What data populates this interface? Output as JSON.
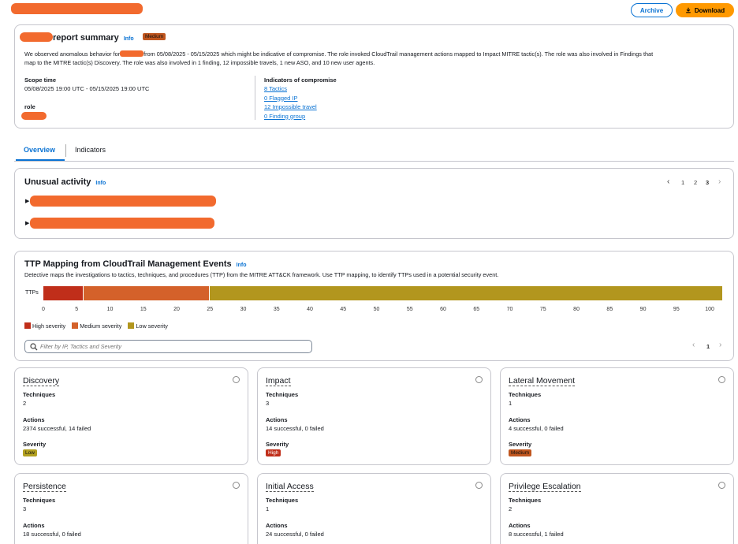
{
  "header": {
    "archive_label": "Archive",
    "download_label": "Download"
  },
  "summary": {
    "title": "report summary",
    "info": "Info",
    "severity": "Medium",
    "desc_prefix": "We observed anomalous behavior for",
    "desc_rest": "from 05/08/2025 - 05/15/2025 which might be indicative of compromise. The role invoked CloudTrail management actions mapped to Impact MITRE tactic(s). The role was also involved in Findings that",
    "desc_line2": "map to the MITRE tactic(s) Discovery. The role was also involved in 1 finding, 12 impossible travels, 1 new ASO, and 10 new user agents.",
    "scope_label": "Scope time",
    "scope_value": "05/08/2025 19:00 UTC - 05/15/2025 19:00 UTC",
    "role_label": "role",
    "ioc_label": "Indicators of compromise",
    "ioc_links": [
      "8 Tactics",
      "0 Flagged IP",
      "12 Impossible travel",
      "0 Finding group"
    ]
  },
  "tabs": [
    "Overview",
    "Indicators"
  ],
  "unusual": {
    "title": "Unusual activity",
    "info": "Info",
    "pages": [
      "1",
      "2",
      "3"
    ],
    "current_page": "3"
  },
  "ttp": {
    "title": "TTP Mapping from CloudTrail Management Events",
    "info": "Info",
    "description": "Detective maps the investigations to tactics, techniques, and procedures (TTP) from the MITRE ATT&CK framework. Use TTP mapping, to identify TTPs used in a potential security event.",
    "row_label": "TTPs",
    "legend": [
      "High severity",
      "Medium severity",
      "Low severity"
    ],
    "filter_placeholder": "Filter by IP, Tactics and Severity",
    "page": "1",
    "colors": {
      "high": "#c02e1a",
      "medium": "#d4612a",
      "low": "#b2961e"
    }
  },
  "chart_data": {
    "type": "bar",
    "orientation": "horizontal-stacked",
    "categories": [
      "TTPs"
    ],
    "series": [
      {
        "name": "High severity",
        "values": [
          6
        ]
      },
      {
        "name": "Medium severity",
        "values": [
          19
        ]
      },
      {
        "name": "Low severity",
        "values": [
          77
        ]
      }
    ],
    "x_ticks": [
      "0",
      "5",
      "10",
      "15",
      "20",
      "25",
      "30",
      "35",
      "40",
      "45",
      "50",
      "55",
      "60",
      "65",
      "70",
      "75",
      "80",
      "85",
      "90",
      "95",
      "100"
    ],
    "xlim": [
      0,
      102
    ]
  },
  "tactics": [
    {
      "name": "Discovery",
      "techniques_label": "Techniques",
      "techniques": "2",
      "actions_label": "Actions",
      "actions": "2374 successful, 14 failed",
      "severity_label": "Severity",
      "severity": "Low"
    },
    {
      "name": "Impact",
      "techniques_label": "Techniques",
      "techniques": "3",
      "actions_label": "Actions",
      "actions": "14 successful, 0 failed",
      "severity_label": "Severity",
      "severity": "High"
    },
    {
      "name": "Lateral Movement",
      "techniques_label": "Techniques",
      "techniques": "1",
      "actions_label": "Actions",
      "actions": "4 successful, 0 failed",
      "severity_label": "Severity",
      "severity": "Medium"
    },
    {
      "name": "Persistence",
      "techniques_label": "Techniques",
      "techniques": "3",
      "actions_label": "Actions",
      "actions": "18 successful, 0 failed"
    },
    {
      "name": "Initial Access",
      "techniques_label": "Techniques",
      "techniques": "1",
      "actions_label": "Actions",
      "actions": "24 successful, 0 failed"
    },
    {
      "name": "Privilege Escalation",
      "techniques_label": "Techniques",
      "techniques": "2",
      "actions_label": "Actions",
      "actions": "8 successful, 1 failed"
    }
  ]
}
